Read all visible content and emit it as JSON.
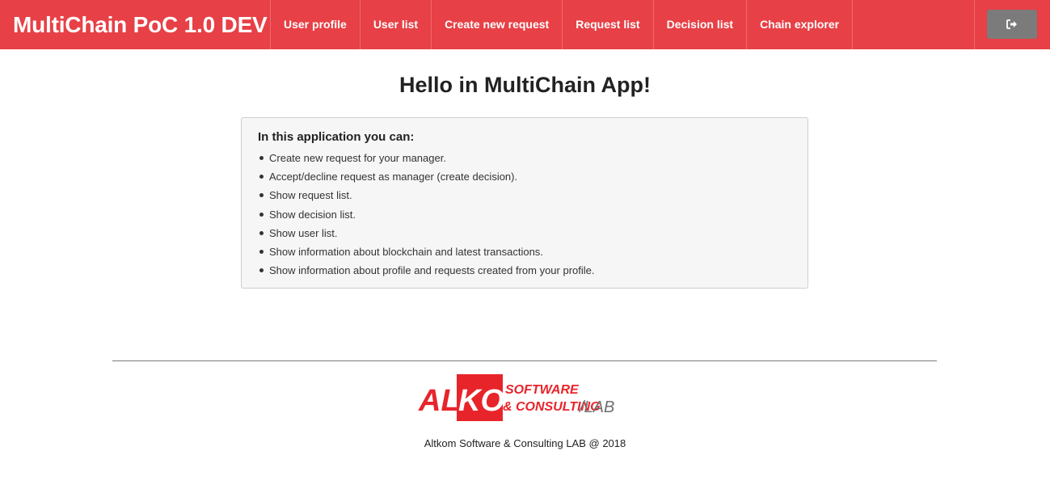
{
  "app": {
    "brand": "MultiChain PoC 1.0 DEV"
  },
  "nav": {
    "items": [
      {
        "label": "User profile"
      },
      {
        "label": "User list"
      },
      {
        "label": "Create new request"
      },
      {
        "label": "Request list"
      },
      {
        "label": "Decision list"
      },
      {
        "label": "Chain explorer"
      }
    ],
    "logout_icon": "sign-out-icon"
  },
  "main": {
    "title": "Hello in MultiChain App!",
    "panel_heading": "In this application you can:",
    "features": [
      "Create new request for your manager.",
      "Accept/decline request as manager (create decision).",
      "Show request list.",
      "Show decision list.",
      "Show user list.",
      "Show information about blockchain and latest transactions.",
      "Show information about profile and requests created from your profile."
    ]
  },
  "footer": {
    "logo": {
      "text_alt": "ALT",
      "text_kom": "KOM",
      "text_software": "SOFTWARE",
      "text_consulting": "& CONSULTING",
      "text_lab": "/LAB"
    },
    "copyright": "Altkom Software & Consulting LAB @ 2018"
  },
  "colors": {
    "navbar": "#e74046",
    "logout_button": "#7b7b7b",
    "logo_red": "#e8242b",
    "logo_gray": "#6d6e71"
  }
}
